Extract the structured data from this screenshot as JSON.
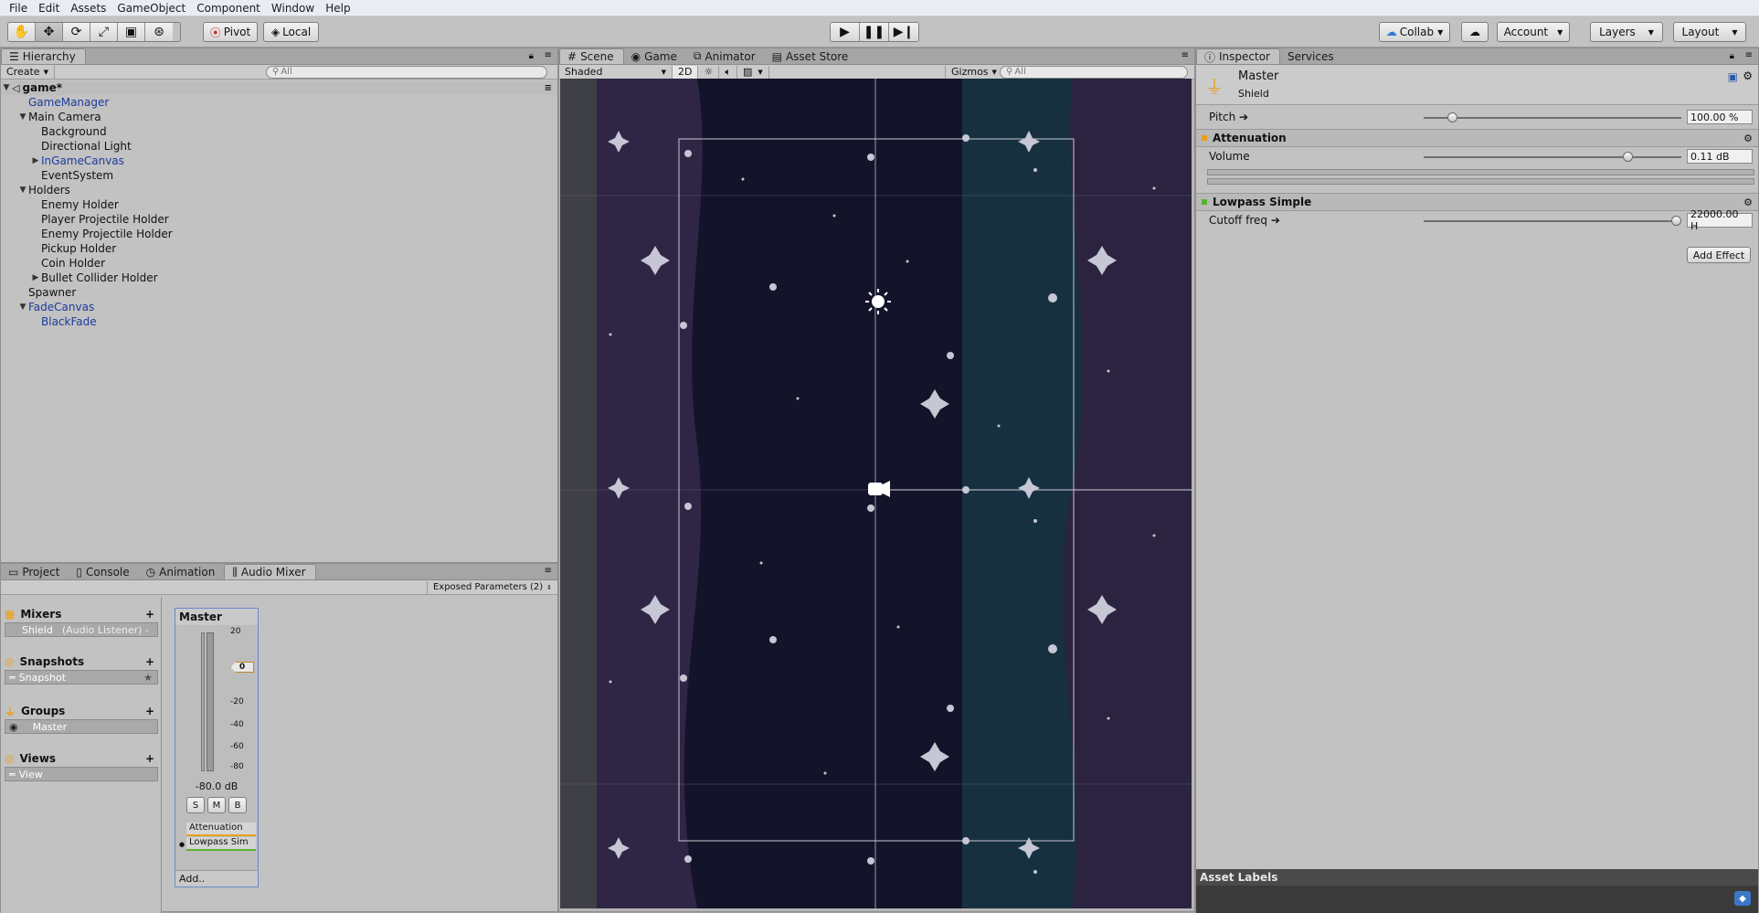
{
  "menu": [
    "File",
    "Edit",
    "Assets",
    "GameObject",
    "Component",
    "Window",
    "Help"
  ],
  "toolbar": {
    "pivot_label": "Pivot",
    "local_label": "Local",
    "collab_label": "Collab",
    "account_label": "Account",
    "layers_label": "Layers",
    "layout_label": "Layout",
    "tools": [
      "hand-tool-icon",
      "move-tool-icon",
      "rotate-tool-icon",
      "scale-tool-icon",
      "rect-tool-icon",
      "transform-tool-icon"
    ]
  },
  "hierarchy": {
    "tab_label": "Hierarchy",
    "create_label": "Create",
    "search_placeholder": "All",
    "scene_name": "game*",
    "items": [
      {
        "label": "GameManager",
        "indent": 0,
        "arrow": "",
        "blue": true
      },
      {
        "label": "Main Camera",
        "indent": 0,
        "arrow": "▼",
        "blue": false
      },
      {
        "label": "Background",
        "indent": 1,
        "arrow": "",
        "blue": false
      },
      {
        "label": "Directional Light",
        "indent": 1,
        "arrow": "",
        "blue": false
      },
      {
        "label": "InGameCanvas",
        "indent": 1,
        "arrow": "▶",
        "blue": true
      },
      {
        "label": "EventSystem",
        "indent": 1,
        "arrow": "",
        "blue": false
      },
      {
        "label": "Holders",
        "indent": 0,
        "arrow": "▼",
        "blue": false
      },
      {
        "label": "Enemy Holder",
        "indent": 1,
        "arrow": "",
        "blue": false
      },
      {
        "label": "Player Projectile Holder",
        "indent": 1,
        "arrow": "",
        "blue": false
      },
      {
        "label": "Enemy Projectile Holder",
        "indent": 1,
        "arrow": "",
        "blue": false
      },
      {
        "label": "Pickup Holder",
        "indent": 1,
        "arrow": "",
        "blue": false
      },
      {
        "label": "Coin Holder",
        "indent": 1,
        "arrow": "",
        "blue": false
      },
      {
        "label": "Bullet Collider Holder",
        "indent": 1,
        "arrow": "▶",
        "blue": false
      },
      {
        "label": "Spawner",
        "indent": 0,
        "arrow": "",
        "blue": false
      },
      {
        "label": "FadeCanvas",
        "indent": 0,
        "arrow": "▼",
        "blue": true
      },
      {
        "label": "BlackFade",
        "indent": 1,
        "arrow": "",
        "blue": true
      }
    ]
  },
  "bottom_tabs": [
    "Project",
    "Console",
    "Animation",
    "Audio Mixer"
  ],
  "audio_mixer": {
    "exposed_params": "Exposed Parameters (2)",
    "sections": [
      {
        "title": "Mixers",
        "item": "Shield",
        "item_extra": "(Audio Listener) -"
      },
      {
        "title": "Snapshots",
        "item": "Snapshot",
        "item_extra": ""
      },
      {
        "title": "Groups",
        "item": "Master",
        "item_extra": ""
      },
      {
        "title": "Views",
        "item": "View",
        "item_extra": ""
      }
    ],
    "strip": {
      "name": "Master",
      "db": "-80.0 dB",
      "scale": [
        "20",
        "0",
        "-20",
        "-40",
        "-60",
        "-80"
      ],
      "buttons": [
        "S",
        "M",
        "B"
      ],
      "effects": [
        "Attenuation",
        "Lowpass Sim"
      ],
      "add_label": "Add.."
    }
  },
  "scene_view": {
    "tabs": [
      "Scene",
      "Game",
      "Animator",
      "Asset Store"
    ],
    "shading": "Shaded",
    "mode_2d": "2D",
    "gizmos": "Gizmos",
    "search_placeholder": "All"
  },
  "inspector": {
    "tabs": [
      "Inspector",
      "Services"
    ],
    "title": "Master",
    "subtitle": "Shield",
    "pitch_label": "Pitch ➔",
    "pitch_value": "100.00 %",
    "pitch_level": 0.11,
    "attenuation_label": "Attenuation",
    "volume_label": "Volume",
    "volume_value": "0.11 dB",
    "volume_level": 0.79,
    "lowpass_label": "Lowpass Simple",
    "cutoff_label": "Cutoff freq ➔",
    "cutoff_value": "22000.00 H",
    "cutoff_level": 0.98,
    "add_effect_label": "Add Effect",
    "asset_labels": "Asset Labels"
  },
  "colors": {
    "hierarchy_blue": "#1c3c9c",
    "scene_bg": "#14142a",
    "attenuation_marker": "#e8a020",
    "lowpass_marker": "#5ab030"
  }
}
